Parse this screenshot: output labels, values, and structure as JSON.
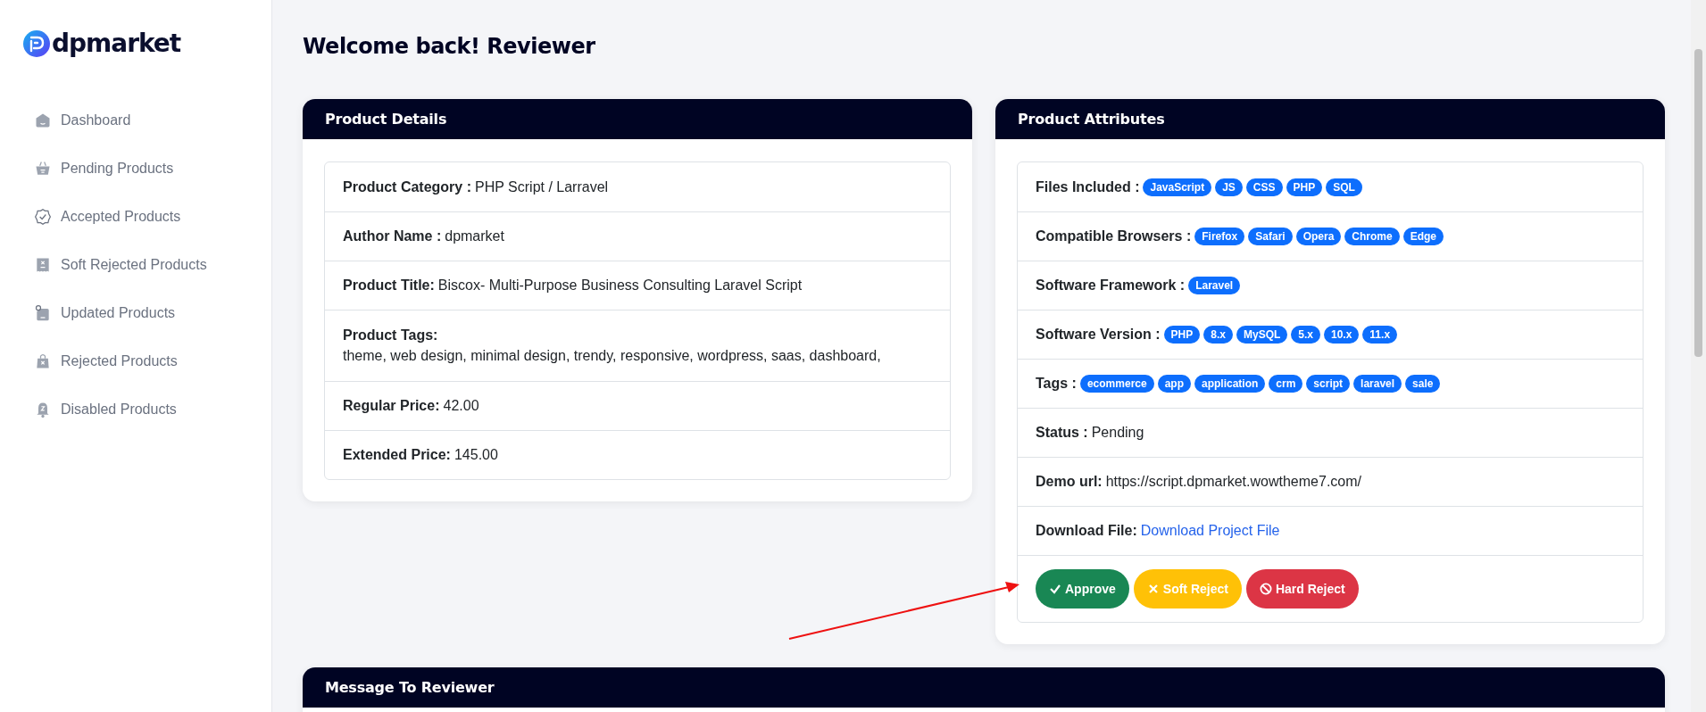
{
  "sidebar": {
    "logo": "dpmarket",
    "items": [
      {
        "label": "Dashboard",
        "kind": "dashboard",
        "selected": false
      },
      {
        "label": "Pending Products",
        "kind": "pending",
        "selected": false
      },
      {
        "label": "Accepted Products",
        "kind": "accepted",
        "selected": false
      },
      {
        "label": "Soft Rejected Products",
        "kind": "soft",
        "selected": false
      },
      {
        "label": "Updated Products",
        "kind": "updated",
        "selected": false
      },
      {
        "label": "Rejected Products",
        "kind": "rejected",
        "selected": false
      },
      {
        "label": "Disabled Products",
        "kind": "disabled",
        "selected": false
      }
    ]
  },
  "page_title": "Welcome back! Reviewer",
  "product_details": {
    "title": "Product Details",
    "rows": [
      {
        "label": "Product Category :",
        "value": "PHP Script / Larravel",
        "kind": "inline"
      },
      {
        "label": "Author Name :",
        "value": "dpmarket",
        "kind": "inline"
      },
      {
        "label": "Product Title:",
        "value": "Biscox- Multi-Purpose Business Consulting Laravel Script",
        "kind": "inline"
      },
      {
        "label": "Product Tags:",
        "value": "theme, web design, minimal design, trendy, responsive, wordpress, saas, dashboard,",
        "kind": "block"
      },
      {
        "label": "Regular Price:",
        "value": "42.00",
        "kind": "inline"
      },
      {
        "label": "Extended Price:",
        "value": "145.00",
        "kind": "inline"
      }
    ]
  },
  "product_attributes": {
    "title": "Product Attributes",
    "rows": [
      {
        "label": "Files Included :",
        "kind": "badges",
        "badges": [
          "JavaScript",
          "JS",
          "CSS",
          "PHP",
          "SQL"
        ]
      },
      {
        "label": "Compatible Browsers :",
        "kind": "badges",
        "badges": [
          "Firefox",
          "Safari",
          "Opera",
          "Chrome",
          "Edge"
        ]
      },
      {
        "label": "Software Framework :",
        "kind": "badges",
        "badges": [
          "Laravel"
        ]
      },
      {
        "label": "Software Version :",
        "kind": "badges",
        "badges": [
          "PHP",
          "8.x",
          "MySQL",
          "5.x",
          "10.x",
          "11.x"
        ]
      },
      {
        "label": "Tags :",
        "kind": "badges",
        "badges": [
          "ecommerce",
          "app",
          "application",
          "crm",
          "script",
          "laravel",
          "sale"
        ]
      },
      {
        "label": "Status :",
        "kind": "text",
        "value": "Pending"
      },
      {
        "label": "Demo url:",
        "kind": "text",
        "value": "https://script.dpmarket.wowtheme7.com/"
      },
      {
        "label": "Download File:",
        "kind": "link",
        "value": "Download Project File"
      }
    ],
    "actions": [
      {
        "label": "Approve",
        "kind": "success"
      },
      {
        "label": "Soft Reject",
        "kind": "warning"
      },
      {
        "label": "Hard Reject",
        "kind": "danger"
      }
    ]
  },
  "message_card": {
    "title": "Message To Reviewer"
  }
}
